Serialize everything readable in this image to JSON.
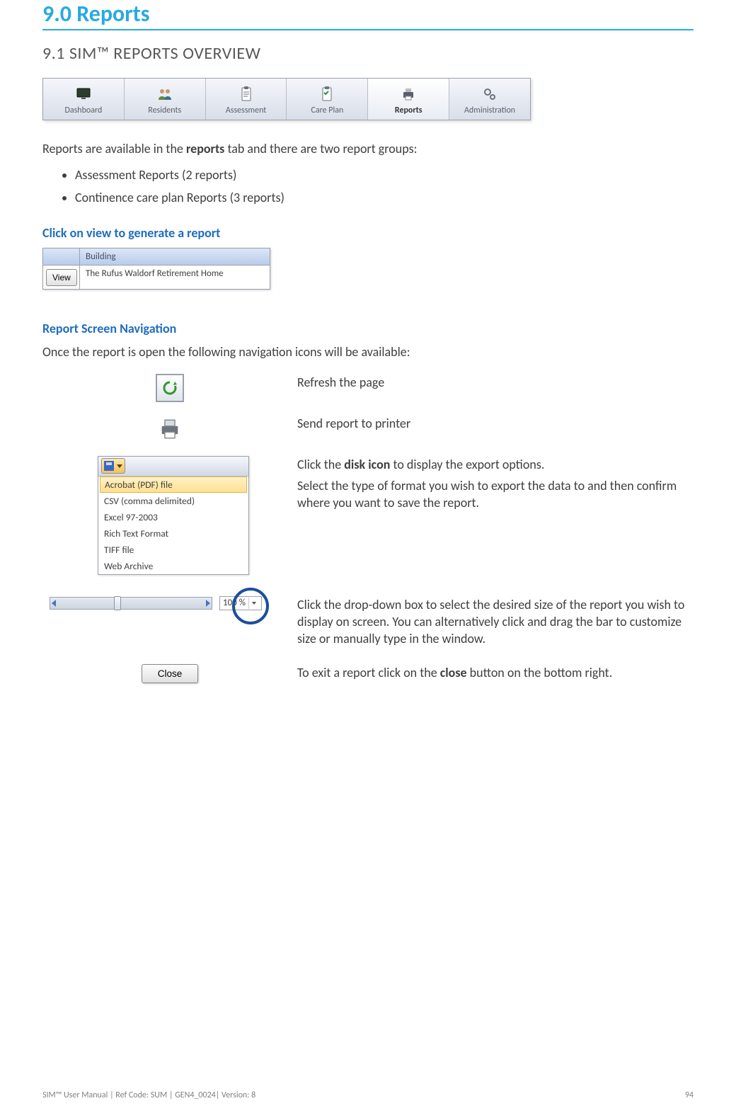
{
  "heading": "9.0 Reports",
  "subheading": "9.1 SIM™ REPORTS OVERVIEW",
  "toolbar": {
    "tabs": [
      {
        "label": "Dashboard"
      },
      {
        "label": "Residents"
      },
      {
        "label": "Assessment"
      },
      {
        "label": "Care Plan"
      },
      {
        "label": "Reports"
      },
      {
        "label": "Administration"
      }
    ]
  },
  "intro_prefix": "Reports are available in the ",
  "intro_bold": "reports",
  "intro_suffix": " tab and there are two report groups:",
  "bullets": [
    "Assessment Reports  (2 reports)",
    "Continence care plan Reports  (3 reports)"
  ],
  "click_view_head": "Click on view to generate a report",
  "view_grid": {
    "header": "Building",
    "button": "View",
    "value": "The Rufus Waldorf Retirement Home"
  },
  "nav_head": "Report Screen Navigation",
  "nav_intro": "Once the report is open the following navigation icons will be available:",
  "nav": {
    "refresh": "Refresh the page",
    "print": "Send report to printer",
    "disk_line1_pre": "Click the ",
    "disk_line1_bold": "disk icon",
    "disk_line1_post": " to display the export options.",
    "disk_line2": "Select the type of format you wish to export the data to and then confirm where you want to save the report.",
    "export_options": [
      "Acrobat (PDF) file",
      "CSV (comma delimited)",
      "Excel 97-2003",
      "Rich Text Format",
      "TIFF file",
      "Web Archive"
    ],
    "zoom_value": "100 %",
    "zoom_desc": "Click the drop-down box to select the desired size of the report you wish to display on screen. You can alternatively click and drag the bar to customize size or manually type in the window.",
    "close_label": "Close",
    "close_pre": "To exit a report click on the ",
    "close_bold": "close",
    "close_post": " button on the bottom right."
  },
  "footer": {
    "left": "SIM™ User Manual | Ref Code: SUM | GEN4_0024| Version: 8",
    "right": "94"
  }
}
